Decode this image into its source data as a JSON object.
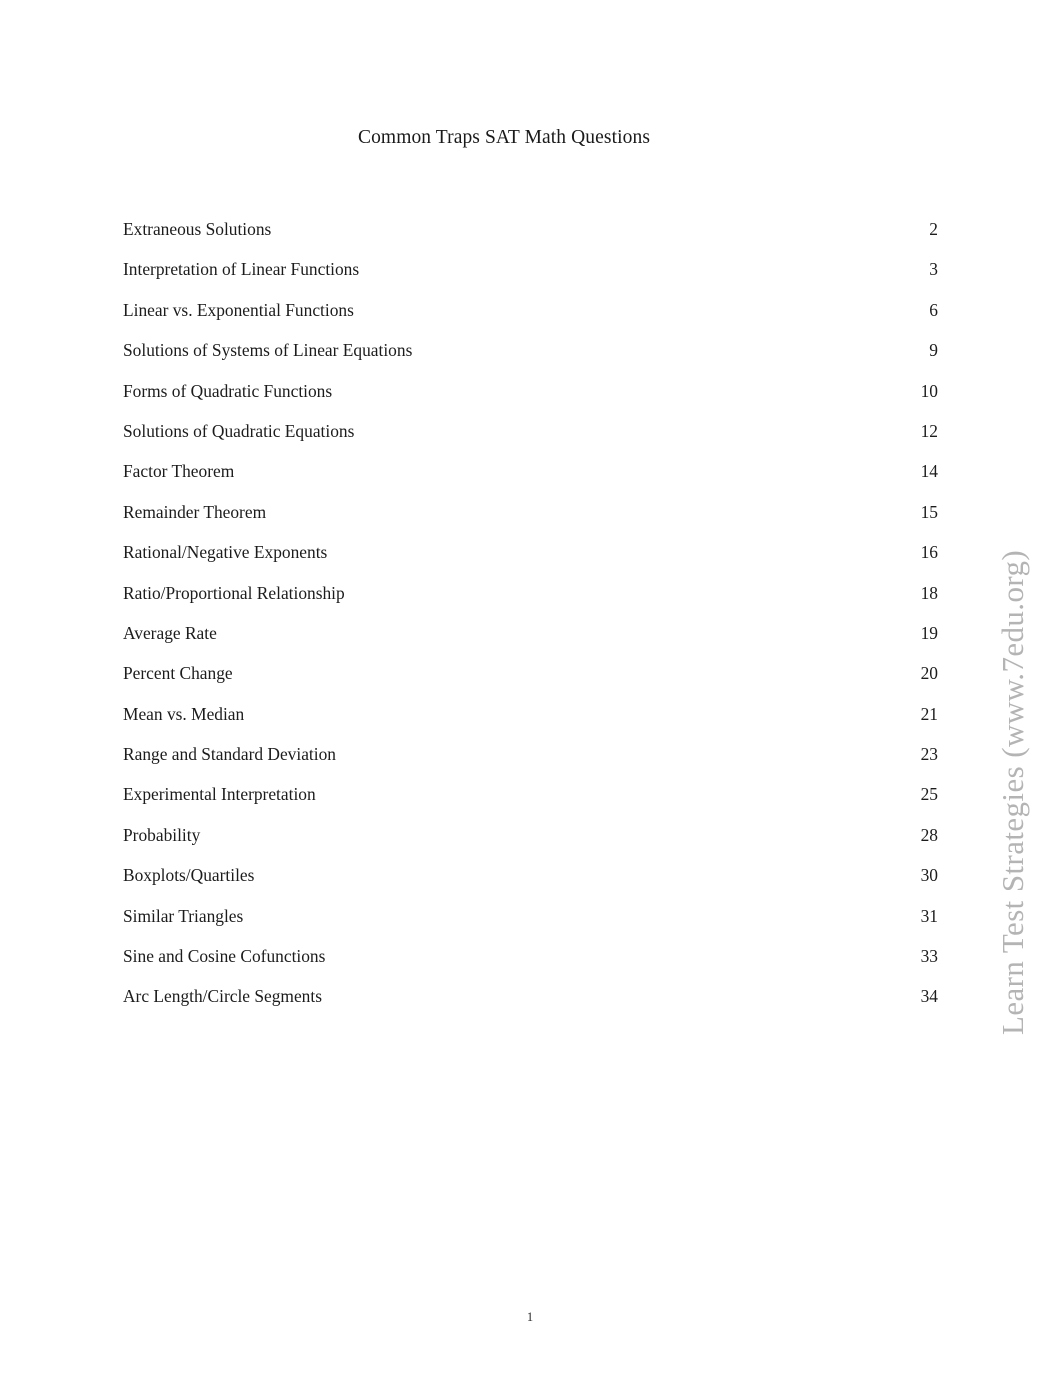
{
  "document": {
    "title": "Common Traps SAT Math Questions",
    "footer_page_number": "1",
    "watermark": "Learn Test Strategies (www.7edu.org)",
    "watermark_color": "#b4b4b4",
    "text_color": "#1c1c1c",
    "background_color": "#ffffff"
  },
  "toc": {
    "entries": [
      {
        "label": "Extraneous Solutions",
        "page": "2"
      },
      {
        "label": "Interpretation of Linear Functions",
        "page": "3"
      },
      {
        "label": "Linear vs. Exponential Functions",
        "page": "6"
      },
      {
        "label": "Solutions of Systems of Linear Equations",
        "page": "9"
      },
      {
        "label": "Forms of Quadratic Functions",
        "page": "10"
      },
      {
        "label": "Solutions of Quadratic Equations",
        "page": "12"
      },
      {
        "label": "Factor Theorem",
        "page": "14"
      },
      {
        "label": "Remainder Theorem",
        "page": "15"
      },
      {
        "label": "Rational/Negative Exponents",
        "page": "16"
      },
      {
        "label": "Ratio/Proportional Relationship",
        "page": "18"
      },
      {
        "label": "Average Rate",
        "page": "19"
      },
      {
        "label": "Percent Change",
        "page": "20"
      },
      {
        "label": "Mean vs. Median",
        "page": "21"
      },
      {
        "label": "Range and Standard Deviation",
        "page": "23"
      },
      {
        "label": "Experimental Interpretation",
        "page": "25"
      },
      {
        "label": "Probability",
        "page": "28"
      },
      {
        "label": "Boxplots/Quartiles",
        "page": "30"
      },
      {
        "label": "Similar Triangles",
        "page": "31"
      },
      {
        "label": "Sine and Cosine Cofunctions",
        "page": "33"
      },
      {
        "label": "Arc Length/Circle Segments",
        "page": "34"
      }
    ]
  }
}
